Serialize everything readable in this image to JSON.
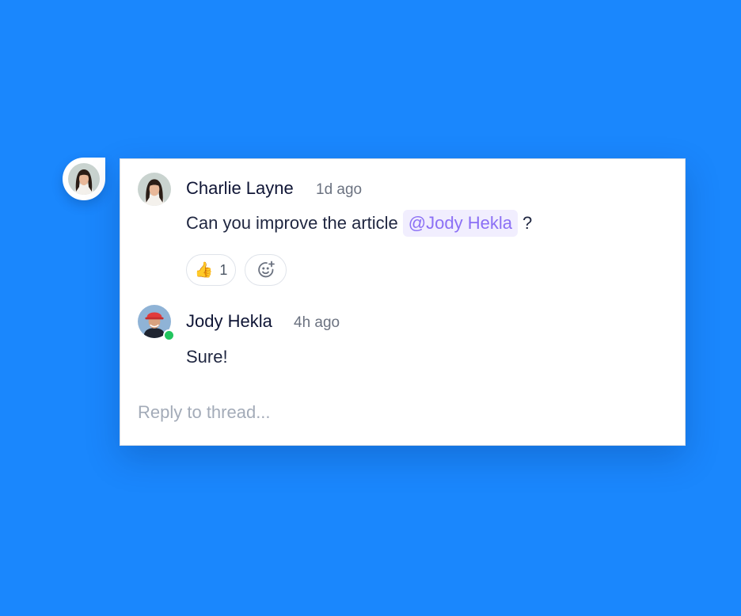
{
  "thread": {
    "comments": [
      {
        "author": "Charlie Layne",
        "time": "1d ago",
        "text_before": "Can you improve the article",
        "mention": "@Jody Hekla",
        "text_after": "?",
        "reactions": [
          {
            "emoji": "👍",
            "count": "1"
          }
        ]
      },
      {
        "author": "Jody Hekla",
        "time": "4h ago",
        "text": "Sure!",
        "online": true
      }
    ],
    "reply_placeholder": "Reply to thread..."
  },
  "colors": {
    "background": "#1a87fd",
    "mention_text": "#8b6ff5",
    "mention_bg": "#f1eefe",
    "online": "#22c55e"
  },
  "icons": {
    "add_reaction": "add-reaction-icon"
  }
}
